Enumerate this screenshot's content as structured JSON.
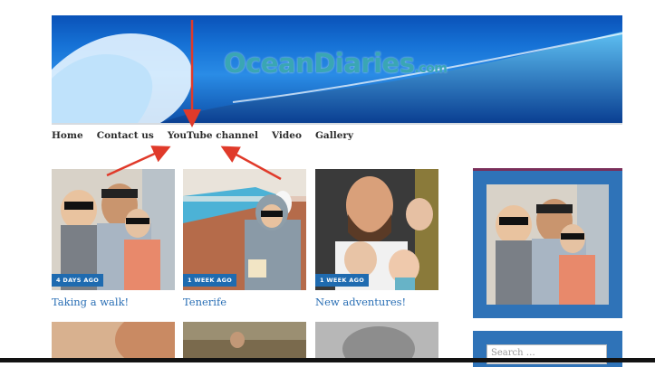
{
  "header": {
    "site_title": "OceanDiaries",
    "site_title_suffix": ".com"
  },
  "nav": {
    "items": [
      "Home",
      "Contact us",
      "YouTube channel",
      "Video",
      "Gallery"
    ]
  },
  "posts": [
    {
      "date": "4 DAYS AGO",
      "title": "Taking a walk!"
    },
    {
      "date": "1 WEEK AGO",
      "title": "Tenerife"
    },
    {
      "date": "1 WEEK AGO",
      "title": "New adventures!"
    }
  ],
  "sidebar": {
    "search_placeholder": "Search …"
  },
  "colors": {
    "accent": "#2f73b8",
    "badge": "#1f6bb0",
    "link": "#2a6fb5",
    "arrow": "#e03a2a"
  }
}
